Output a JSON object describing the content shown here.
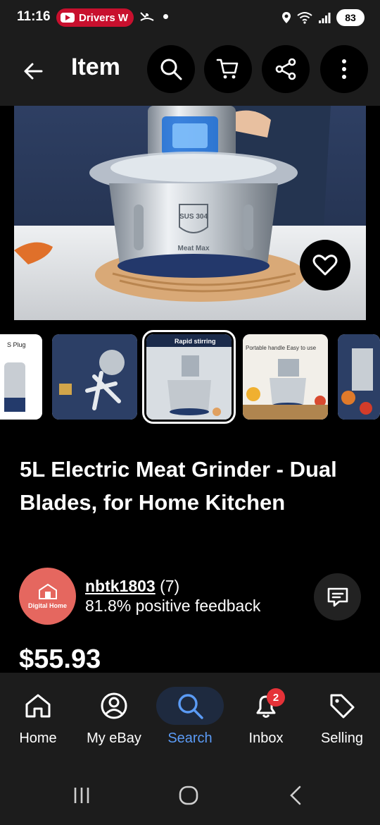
{
  "status_bar": {
    "time": "11:16",
    "notification_chip": "Drivers W",
    "battery": "83",
    "icons": [
      "youtube-icon",
      "missed-call-icon",
      "dot-icon",
      "location-icon",
      "wifi-icon",
      "signal-icon",
      "battery-icon"
    ]
  },
  "app_bar": {
    "title": "Item",
    "buttons": [
      "back-arrow-icon",
      "search-icon",
      "cart-icon",
      "share-icon",
      "more-vertical-icon"
    ]
  },
  "hero": {
    "badge_text": "SUS 304",
    "product_label": "Meat Max",
    "favorite_icon": "heart-icon"
  },
  "thumbnails": [
    {
      "caption": "S Plug",
      "selected": false
    },
    {
      "caption": "",
      "selected": false
    },
    {
      "caption": "Rapid stirring",
      "selected": true
    },
    {
      "caption": "Portable handle Easy to use",
      "selected": false
    },
    {
      "caption": "",
      "selected": false
    }
  ],
  "product": {
    "title": "5L Electric Meat Grinder - Dual Blades, for Home Kitchen",
    "price": "$55.93"
  },
  "seller": {
    "username": "nbtk1803",
    "rating_count": "(7)",
    "feedback": "81.8% positive feedback",
    "avatar_text": "Digital Home"
  },
  "bottom_nav": {
    "items": [
      {
        "label": "Home",
        "icon": "home-icon",
        "active": false
      },
      {
        "label": "My eBay",
        "icon": "profile-icon",
        "active": false
      },
      {
        "label": "Search",
        "icon": "search-icon",
        "active": true
      },
      {
        "label": "Inbox",
        "icon": "bell-icon",
        "active": false,
        "badge": "2"
      },
      {
        "label": "Selling",
        "icon": "tag-icon",
        "active": false
      }
    ]
  },
  "colors": {
    "surface": "#1c1c1c",
    "background": "#000000",
    "accent": "#5b9bf5",
    "badge": "#e53238",
    "chip": "#c8102e"
  }
}
